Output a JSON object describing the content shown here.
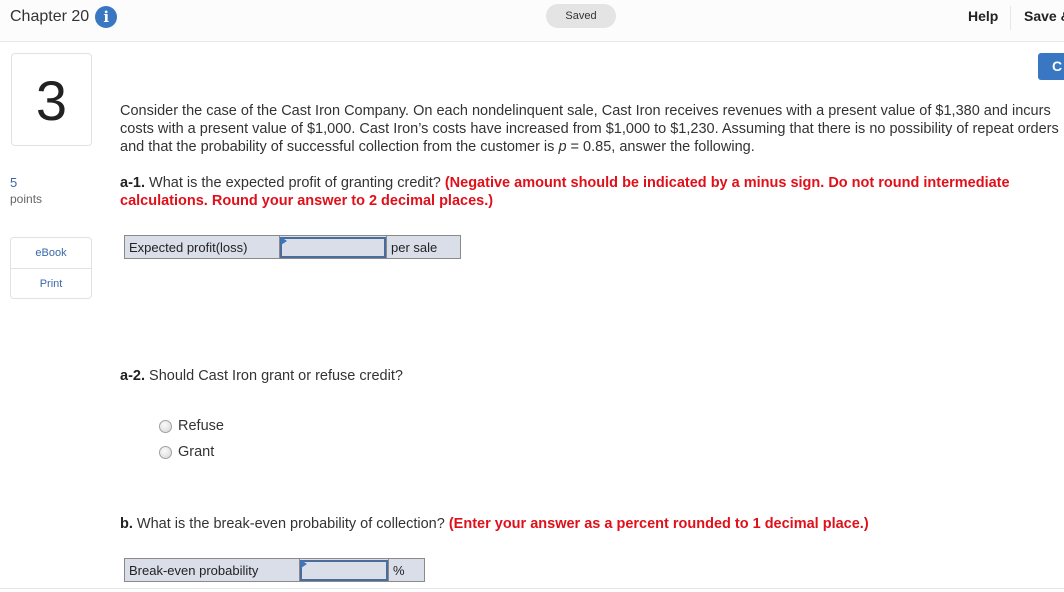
{
  "header": {
    "chapter": "Chapter 20",
    "info_icon": "i",
    "saved_status": "Saved",
    "help_label": "Help",
    "save_exit_label": "Save &"
  },
  "side_button_label": "C",
  "question": {
    "number": "3",
    "points_value": "5",
    "points_label": "points",
    "tools": [
      "eBook",
      "Print"
    ]
  },
  "problem": {
    "intro_part1": "Consider the case of the Cast Iron Company. On each nondelinquent sale, Cast Iron receives revenues with a present value of $1,380 and incurs costs with a present value of $1,000. Cast Iron’s costs have increased from $1,000 to $1,230. Assuming that there is no possibility of repeat orders and that the probability of successful collection from the customer is ",
    "intro_var": "p",
    "intro_part2": " = 0.85, answer the following."
  },
  "a1": {
    "tag": "a-1.",
    "text": " What is the expected profit of granting credit? ",
    "instruction": "(Negative amount should be indicated by a minus sign. Do not round intermediate calculations. Round your answer to 2 decimal places.)",
    "row_label": "Expected profit(loss)",
    "input_value": "",
    "unit": "per sale"
  },
  "a2": {
    "tag": "a-2.",
    "text": " Should Cast Iron grant or refuse credit?",
    "options": [
      "Refuse",
      "Grant"
    ],
    "selected": null
  },
  "b": {
    "tag": "b.",
    "text": " What is the break-even probability of collection? ",
    "instruction": "(Enter your answer as a percent rounded to 1 decimal place.)",
    "row_label": "Break-even probability",
    "input_value": "",
    "unit": "%"
  }
}
